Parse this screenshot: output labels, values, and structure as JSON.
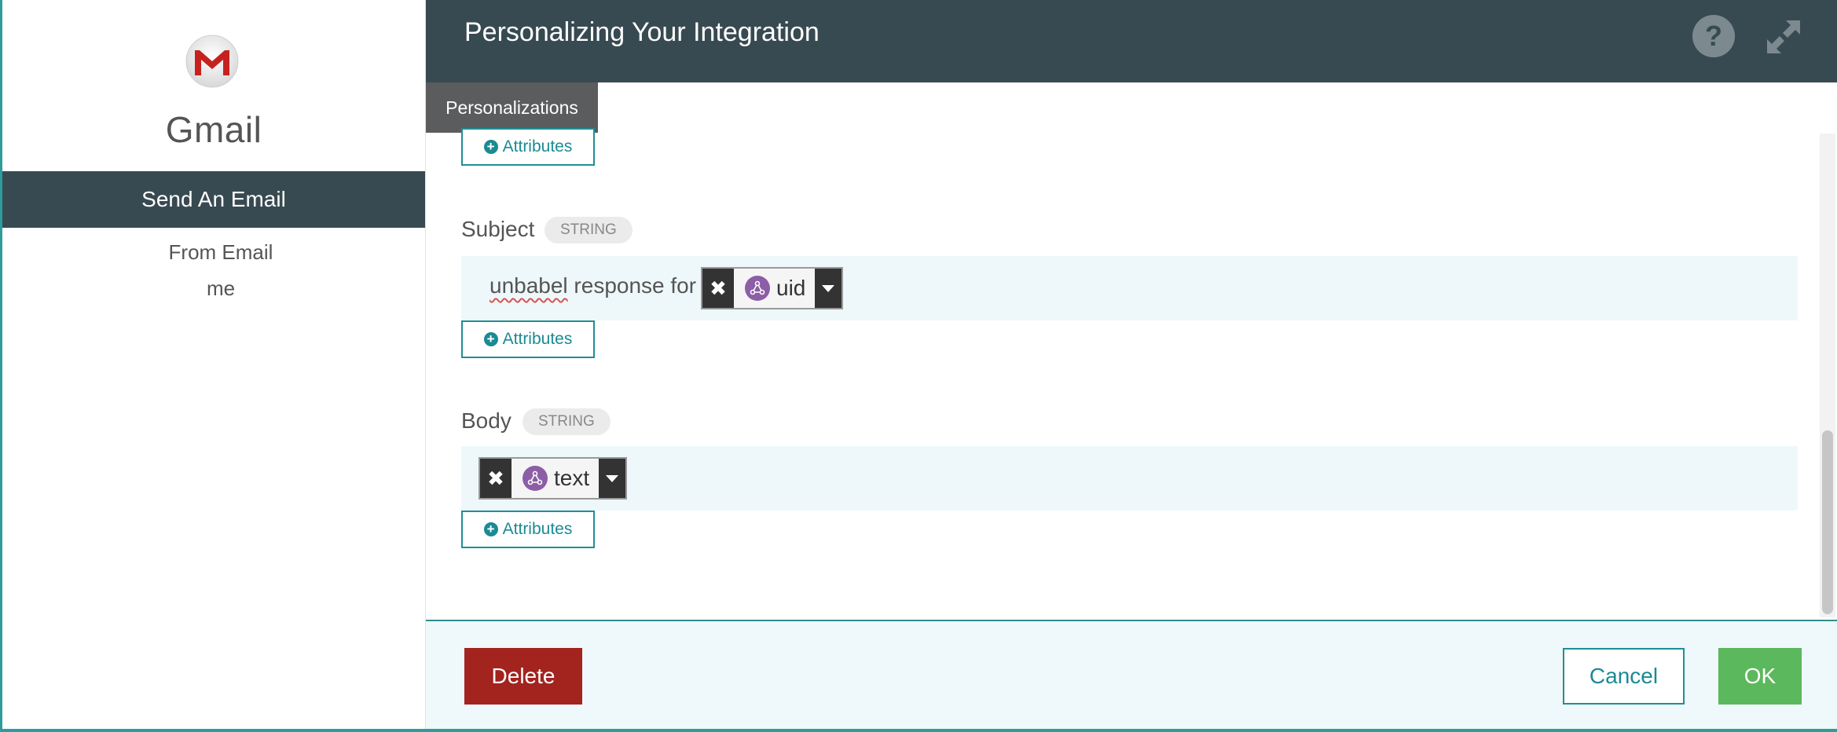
{
  "sidebar": {
    "app_name": "Gmail",
    "action": "Send An Email",
    "field_label": "From Email",
    "field_value": "me",
    "logo_icon": "gmail-logo"
  },
  "header": {
    "title": "Personalizing Your Integration",
    "help_icon": "help-icon",
    "expand_icon": "expand-icon"
  },
  "tabs": [
    {
      "label": "Personalizations"
    }
  ],
  "attributes_label": "Attributes",
  "fields": {
    "subject": {
      "label": "Subject",
      "type": "STRING",
      "static_text_part1": "unbabel",
      "static_text_part2": " response for",
      "token": "uid"
    },
    "body": {
      "label": "Body",
      "type": "STRING",
      "token": "text"
    }
  },
  "footer": {
    "delete": "Delete",
    "cancel": "Cancel",
    "ok": "OK"
  },
  "colors": {
    "header_bg": "#384a51",
    "accent": "#1b8a93",
    "delete": "#a3231f",
    "ok": "#5cb85c",
    "token_icon": "#8b5ea6"
  }
}
